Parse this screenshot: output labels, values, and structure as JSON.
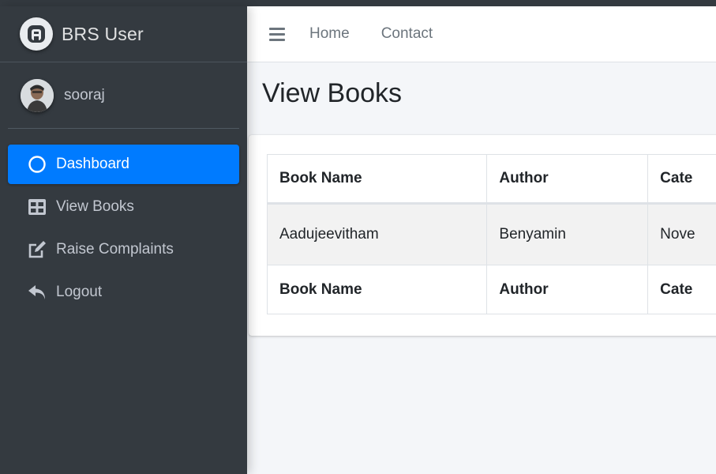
{
  "brand": {
    "name": "BRS User",
    "logo_icon": "brand-logo-icon"
  },
  "user": {
    "name": "sooraj"
  },
  "sidebar": {
    "items": [
      {
        "label": "Dashboard",
        "icon": "circle-icon",
        "active": true
      },
      {
        "label": "View Books",
        "icon": "table-icon",
        "active": false
      },
      {
        "label": "Raise Complaints",
        "icon": "edit-icon",
        "active": false
      },
      {
        "label": "Logout",
        "icon": "reply-icon",
        "active": false
      }
    ]
  },
  "navbar": {
    "home": "Home",
    "contact": "Contact"
  },
  "page": {
    "title": "View Books"
  },
  "table": {
    "headers": [
      "Book Name",
      "Author",
      "Cate"
    ],
    "rows": [
      [
        "Aadujeevitham",
        "Benyamin",
        "Nove"
      ]
    ],
    "footers": [
      "Book Name",
      "Author",
      "Cate"
    ]
  },
  "colors": {
    "sidebar_bg": "#343a40",
    "accent": "#007bff",
    "content_bg": "#f4f6f9"
  }
}
